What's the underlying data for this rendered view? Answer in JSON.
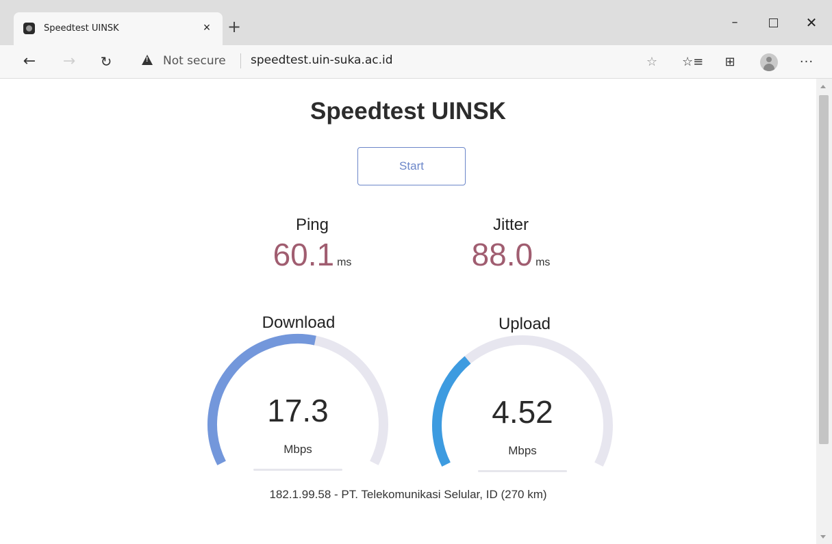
{
  "browser": {
    "tab_title": "Speedtest UINSK",
    "tab_close": "×",
    "new_tab": "+",
    "security_label": "Not secure",
    "url": "speedtest.uin-suka.ac.id"
  },
  "page": {
    "title": "Speedtest UINSK",
    "start_label": "Start",
    "ping": {
      "label": "Ping",
      "value": "60.1",
      "unit": "ms"
    },
    "jitter": {
      "label": "Jitter",
      "value": "88.0",
      "unit": "ms"
    },
    "download": {
      "label": "Download",
      "value": "17.3",
      "unit": "Mbps",
      "gauge_fraction": 0.55
    },
    "upload": {
      "label": "Upload",
      "value": "4.52",
      "unit": "Mbps",
      "gauge_fraction": 0.33
    },
    "server_info": "182.1.99.58 - PT. Telekomunikasi Selular, ID (270 km)"
  },
  "colors": {
    "download_arc": "#7397db",
    "upload_arc": "#3d9be0",
    "track": "#e7e6ef",
    "value_accent": "#a05d70",
    "start_border": "#6b86c9"
  },
  "icons": {
    "back": "back-arrow-icon",
    "forward": "forward-arrow-icon",
    "reload": "reload-icon",
    "warning": "warning-icon",
    "favorite": "star-icon",
    "favorites_list": "favorites-list-icon",
    "collections": "collections-icon",
    "profile": "profile-icon",
    "more": "more-icon"
  }
}
